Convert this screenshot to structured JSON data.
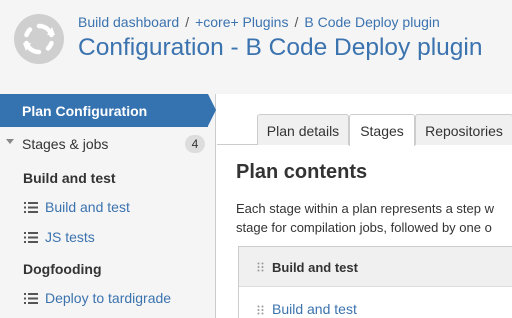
{
  "header": {
    "breadcrumb": [
      "Build dashboard",
      "+core+ Plugins",
      "B Code Deploy plugin"
    ],
    "title": "Configuration - B Code Deploy plugin"
  },
  "sidebar": {
    "active_item": "Plan Configuration",
    "stages": {
      "label": "Stages & jobs",
      "count": "4"
    },
    "groups": [
      {
        "name": "Build and test",
        "jobs": [
          "Build and test",
          "JS tests"
        ]
      },
      {
        "name": "Dogfooding",
        "jobs": [
          "Deploy to tardigrade"
        ]
      }
    ]
  },
  "main": {
    "tabs": [
      "Plan details",
      "Stages",
      "Repositories"
    ],
    "active_tab": "Stages",
    "section_title": "Plan contents",
    "description": [
      "Each stage within a plan represents a step w",
      "stage for compilation jobs, followed by one o"
    ],
    "stage": {
      "name": "Build and test",
      "job": "Build and test"
    }
  },
  "colors": {
    "accent": "#3572b0",
    "link": "#3b73af",
    "header_bg": "#f5f5f5"
  },
  "icons": [
    "refresh-logo-icon",
    "chevron-down-icon",
    "list-icon",
    "drag-handle-icon"
  ]
}
